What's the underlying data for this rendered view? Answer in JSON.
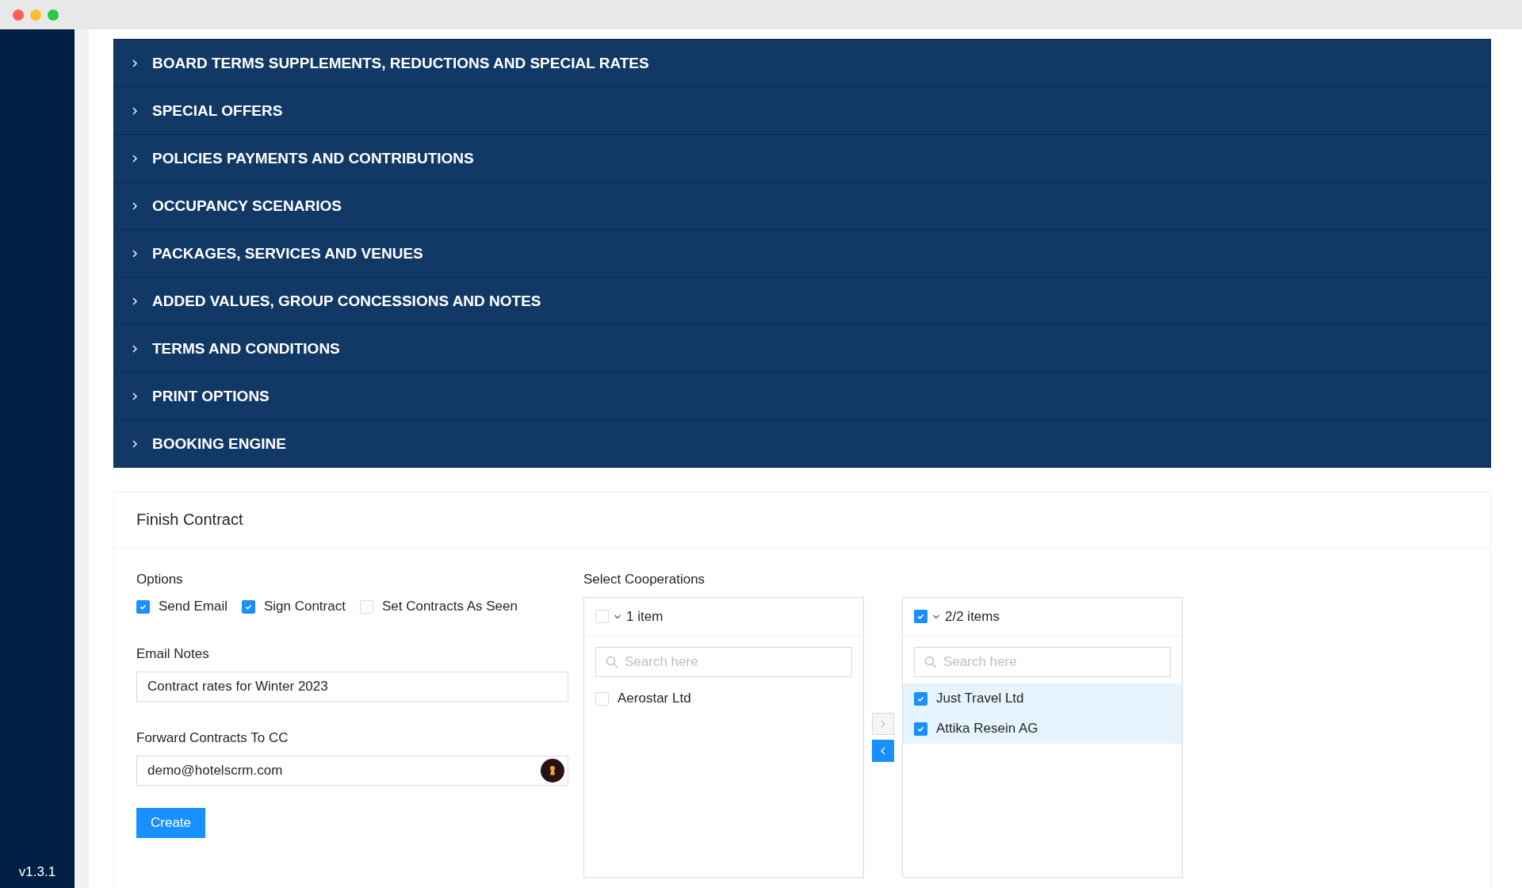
{
  "window": {
    "controls": [
      {
        "kind": "close"
      },
      {
        "kind": "minimize"
      },
      {
        "kind": "zoom"
      }
    ]
  },
  "sidebar": {
    "version": "v1.3.1"
  },
  "sections": [
    {
      "label": "BOARD TERMS SUPPLEMENTS, REDUCTIONS AND SPECIAL RATES",
      "expanded": false
    },
    {
      "label": "SPECIAL OFFERS",
      "expanded": false
    },
    {
      "label": "POLICIES PAYMENTS AND CONTRIBUTIONS",
      "expanded": false
    },
    {
      "label": "OCCUPANCY SCENARIOS",
      "expanded": false
    },
    {
      "label": "PACKAGES, SERVICES AND VENUES",
      "expanded": false
    },
    {
      "label": "ADDED VALUES, GROUP CONCESSIONS AND NOTES",
      "expanded": false
    },
    {
      "label": "TERMS AND CONDITIONS",
      "expanded": false
    },
    {
      "label": "PRINT OPTIONS",
      "expanded": false
    },
    {
      "label": "BOOKING ENGINE",
      "expanded": false
    }
  ],
  "finish_contract": {
    "title": "Finish Contract",
    "options_label": "Options",
    "options": [
      {
        "label": "Send Email",
        "checked": true
      },
      {
        "label": "Sign Contract",
        "checked": true
      },
      {
        "label": "Set Contracts As Seen",
        "checked": false
      }
    ],
    "email_notes": {
      "label": "Email Notes",
      "value": "Contract rates for Winter 2023"
    },
    "forward_cc": {
      "label": "Forward Contracts To CC",
      "value": "demo@hotelscrm.com"
    },
    "create_button": "Create",
    "cooperations": {
      "label": "Select Cooperations",
      "lists": [
        {
          "count": "1 item",
          "checked": false,
          "search_placeholder": "Search here",
          "items": [
            {
              "label": "Aerostar Ltd",
              "checked": false
            }
          ]
        },
        {
          "count": "2/2 items",
          "checked": true,
          "search_placeholder": "Search here",
          "items": [
            {
              "label": "Just Travel Ltd",
              "checked": true
            },
            {
              "label": "Attika Resein AG",
              "checked": true
            }
          ]
        }
      ],
      "move_buttons": [
        {
          "kind": "right",
          "disabled": true
        },
        {
          "kind": "left",
          "disabled": false
        }
      ]
    }
  }
}
